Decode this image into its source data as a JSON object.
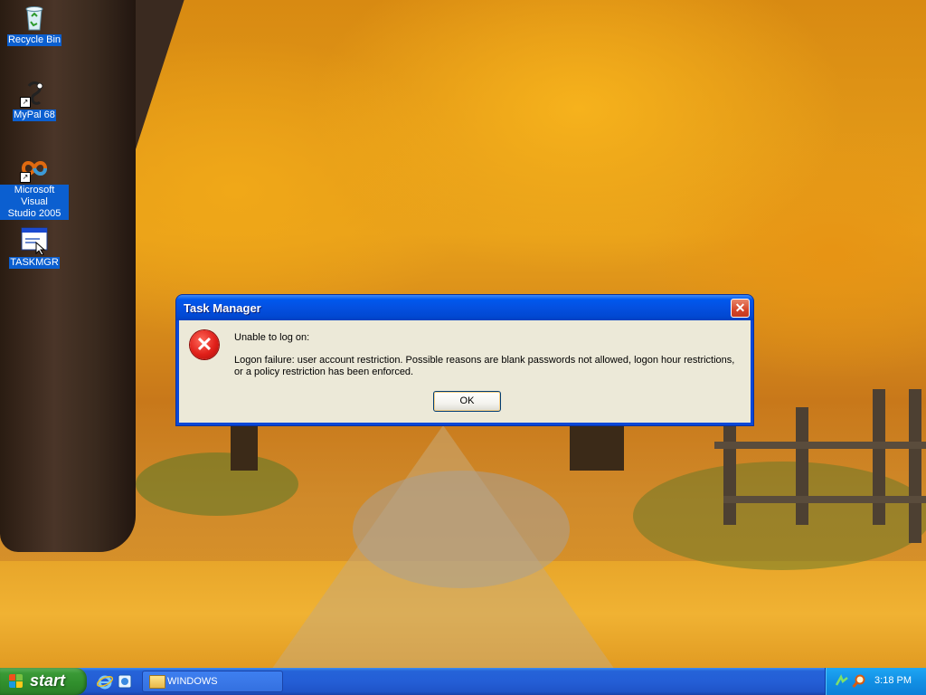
{
  "desktop": {
    "icons": [
      {
        "label": "Recycle Bin",
        "icon": "recycle-bin-icon"
      },
      {
        "label": "MyPal 68",
        "icon": "mypal-icon"
      },
      {
        "label": "Microsoft Visual\nStudio 2005",
        "label_line1": "Microsoft Visual",
        "label_line2": "Studio 2005",
        "icon": "visual-studio-icon"
      },
      {
        "label": "TASKMGR",
        "icon": "taskmgr-icon"
      }
    ]
  },
  "dialog": {
    "title": "Task Manager",
    "close_glyph": "✕",
    "icon": "error-icon",
    "message_heading": "Unable to log on:",
    "message_body": "Logon failure: user account restriction.  Possible reasons are blank passwords not allowed, logon hour restrictions, or a policy restriction has been enforced.",
    "ok_label": "OK"
  },
  "taskbar": {
    "start_label": "start",
    "quick_launch": [
      "internet-explorer-icon",
      "media-icon"
    ],
    "tasks": [
      {
        "label": "WINDOWS",
        "icon": "folder-icon"
      }
    ],
    "tray_icons": [
      "network-icon",
      "search-icon"
    ],
    "clock": "3:18 PM"
  },
  "colors": {
    "titlebar": "#0058ee",
    "dialog_bg": "#ece9d8",
    "taskbar": "#245ed6",
    "start_button": "#3a9a36",
    "tray": "#1290e4",
    "error": "#e0201a"
  }
}
